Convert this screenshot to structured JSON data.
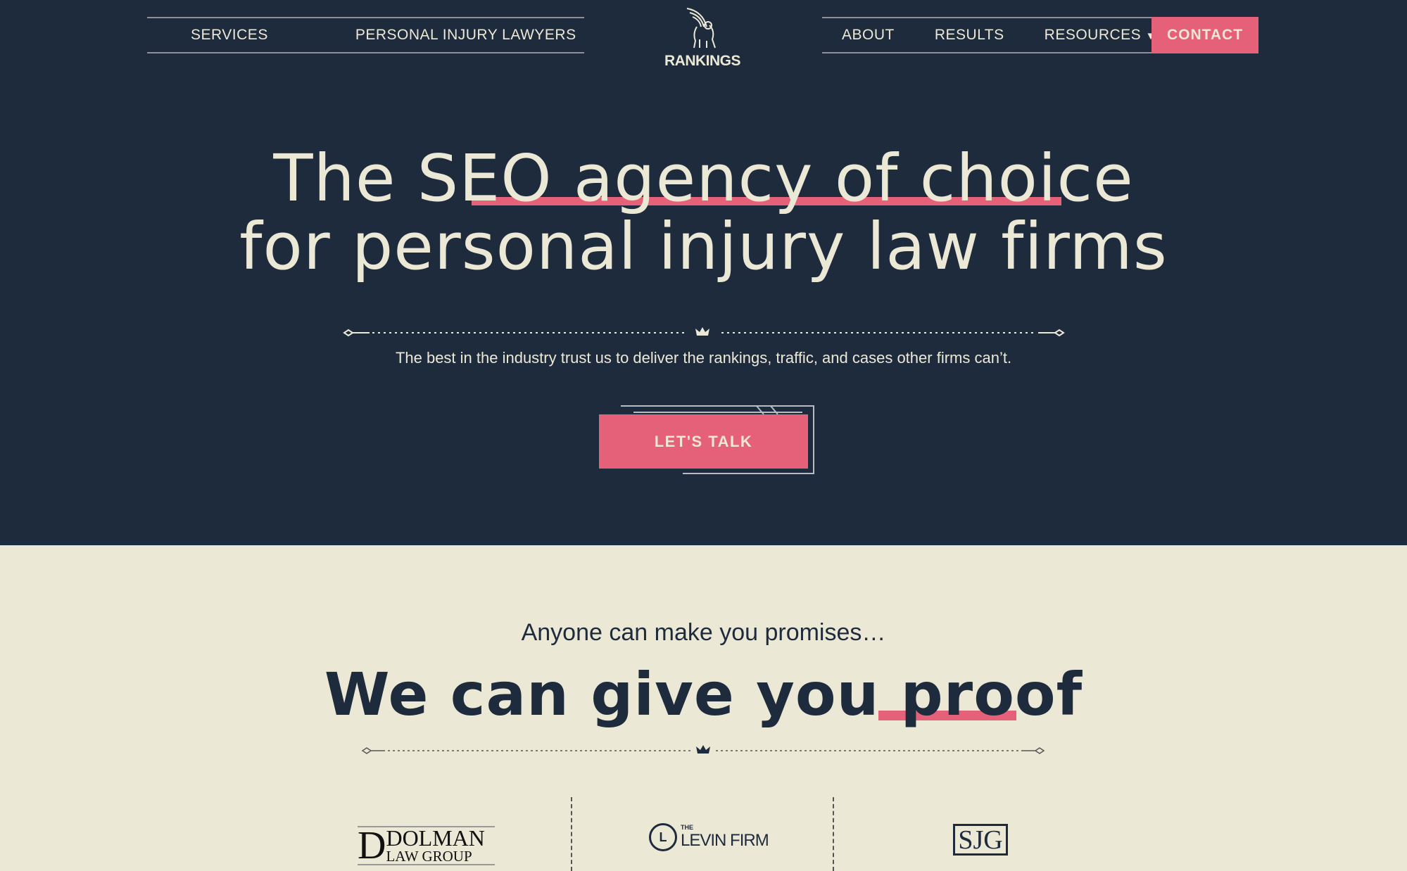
{
  "nav": {
    "left": [
      "SERVICES",
      "PERSONAL INJURY LAWYERS"
    ],
    "right": [
      "ABOUT",
      "RESULTS",
      "RESOURCES"
    ],
    "contact": "CONTACT",
    "logo": "RANKINGS"
  },
  "hero": {
    "line1_pre": "The ",
    "line1_ul": "SEO agency of choice",
    "line2": "for personal injury law firms",
    "subtitle": "The best in the industry trust us to deliver the rankings, traffic, and cases other firms can’t.",
    "cta": "LET'S TALK"
  },
  "proof": {
    "tagline": "Anyone can make you promises…",
    "headline_pre": "We can give you ",
    "headline_ul": "proof"
  },
  "clients": {
    "dolman_main": "DOLMAN",
    "dolman_sub": "LAW GROUP",
    "levin_the": "THE",
    "levin": "LEVIN FIRM",
    "sjg": "SJG"
  },
  "colors": {
    "navy": "#1e2b3d",
    "pink": "#e5617a",
    "cream": "#ece8d6"
  }
}
